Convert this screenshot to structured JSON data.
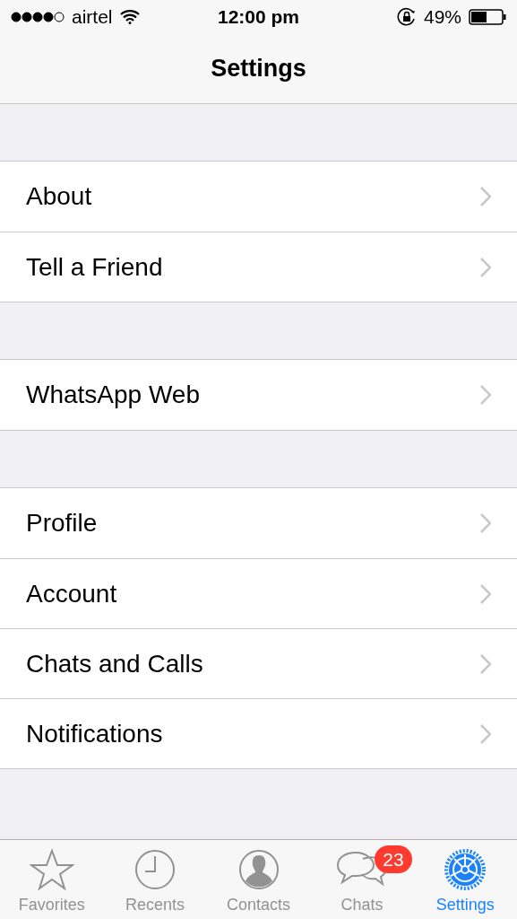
{
  "status_bar": {
    "carrier": "airtel",
    "time": "12:00 pm",
    "battery": "49%"
  },
  "nav_bar": {
    "title": "Settings"
  },
  "groups": [
    {
      "items": [
        {
          "label": "About"
        },
        {
          "label": "Tell a Friend"
        }
      ]
    },
    {
      "items": [
        {
          "label": "WhatsApp Web"
        }
      ]
    },
    {
      "items": [
        {
          "label": "Profile"
        },
        {
          "label": "Account"
        },
        {
          "label": "Chats and Calls"
        },
        {
          "label": "Notifications"
        }
      ]
    }
  ],
  "tab_bar": [
    {
      "kind": "star",
      "label": "Favorites",
      "selected": false
    },
    {
      "kind": "clock",
      "label": "Recents",
      "selected": false
    },
    {
      "kind": "person",
      "label": "Contacts",
      "selected": false
    },
    {
      "kind": "bubbles",
      "label": "Chats",
      "selected": false,
      "badge": "23"
    },
    {
      "kind": "gear",
      "label": "Settings",
      "selected": true
    }
  ]
}
